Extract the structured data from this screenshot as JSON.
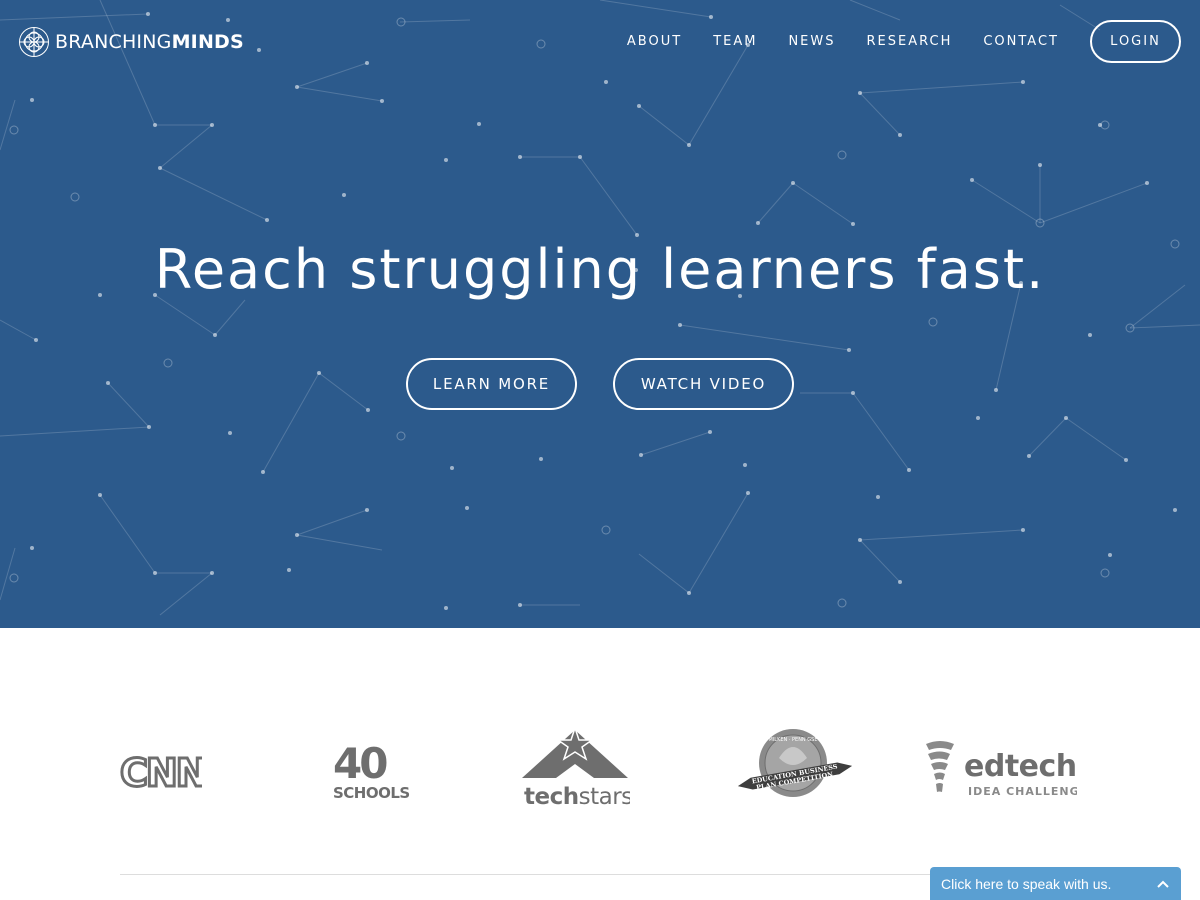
{
  "brand": {
    "name_light": "BRANCHING",
    "name_bold": "MINDS",
    "icon": "branching-minds-logo-icon"
  },
  "nav": {
    "items": [
      {
        "label": "ABOUT"
      },
      {
        "label": "TEAM"
      },
      {
        "label": "NEWS"
      },
      {
        "label": "RESEARCH"
      },
      {
        "label": "CONTACT"
      }
    ],
    "login_label": "LOGIN"
  },
  "hero": {
    "headline": "Reach struggling learners fast.",
    "cta_learn": "LEARN MORE",
    "cta_watch": "WATCH VIDEO"
  },
  "press": {
    "logos": [
      {
        "name": "CNN",
        "text": "CNN"
      },
      {
        "name": "40 Schools",
        "text_top": "40",
        "text_bottom": "SCHOOLS"
      },
      {
        "name": "Techstars",
        "text_a": "tech",
        "text_b": "stars"
      },
      {
        "name": "Milken Penn GSE",
        "top": "MILKEN · PENN GSE",
        "ribbon1": "EDUCATION BUSINESS",
        "ribbon2": "PLAN COMPETITION"
      },
      {
        "name": "Edtech Idea Challenge",
        "title": "edtech",
        "subtitle": "IDEA CHALLENGE"
      }
    ]
  },
  "chat": {
    "label": "Click here to speak with us.",
    "icon": "chevron-up-icon"
  },
  "colors": {
    "hero_bg": "#2c5a8c",
    "logo_gray": "#6e6e6e",
    "chat_bg": "#5a9fd2"
  }
}
